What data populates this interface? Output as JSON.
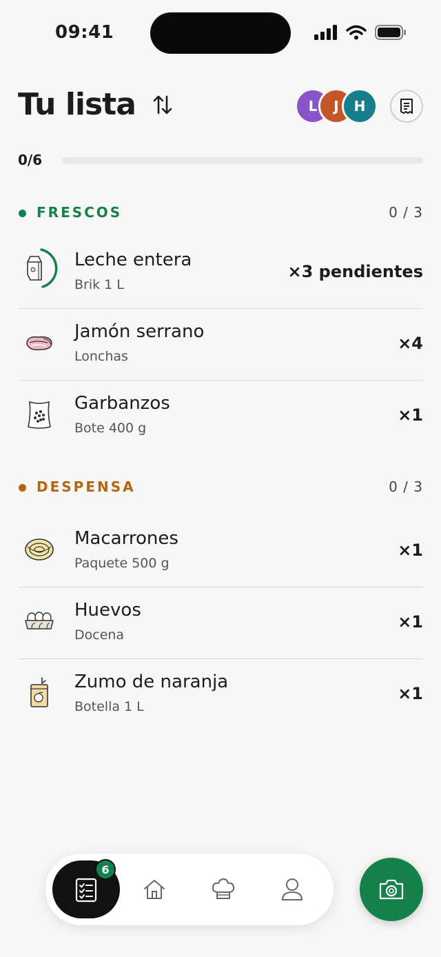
{
  "status_bar": {
    "time": "09:41"
  },
  "header": {
    "title": "Tu lista",
    "avatars": [
      {
        "initial": "L",
        "color": "#8a54c8"
      },
      {
        "initial": "J",
        "color": "#c4562a"
      },
      {
        "initial": "H",
        "color": "#177f8c"
      }
    ]
  },
  "progress": {
    "label": "0/6",
    "fraction": 0
  },
  "sections": [
    {
      "title": "FRESCOS",
      "count": "0 / 3",
      "color": "#14804a",
      "items": [
        {
          "name": "Leche entera",
          "sub": "Brik 1 L",
          "qty": "×3 pendientes",
          "icon": "milk-carton-icon"
        },
        {
          "name": "Jamón serrano",
          "sub": "Lonchas",
          "qty": "×4",
          "icon": "ham-slices-icon"
        },
        {
          "name": "Garbanzos",
          "sub": "Bote 400 g",
          "qty": "×1",
          "icon": "chickpea-bag-icon"
        }
      ]
    },
    {
      "title": "DESPENSA",
      "count": "0 / 3",
      "color": "#b5650f",
      "items": [
        {
          "name": "Macarrones",
          "sub": "Paquete 500 g",
          "qty": "×1",
          "icon": "pasta-nest-icon"
        },
        {
          "name": "Huevos",
          "sub": "Docena",
          "qty": "×1",
          "icon": "egg-carton-icon"
        },
        {
          "name": "Zumo de naranja",
          "sub": "Botella 1 L",
          "qty": "×1",
          "icon": "juice-box-icon"
        }
      ]
    }
  ],
  "nav": {
    "badge": "6",
    "items": [
      "list-icon",
      "home-icon",
      "chef-hat-icon",
      "profile-icon"
    ]
  },
  "colors": {
    "accent": "#14804a",
    "pantry": "#b5650f"
  }
}
